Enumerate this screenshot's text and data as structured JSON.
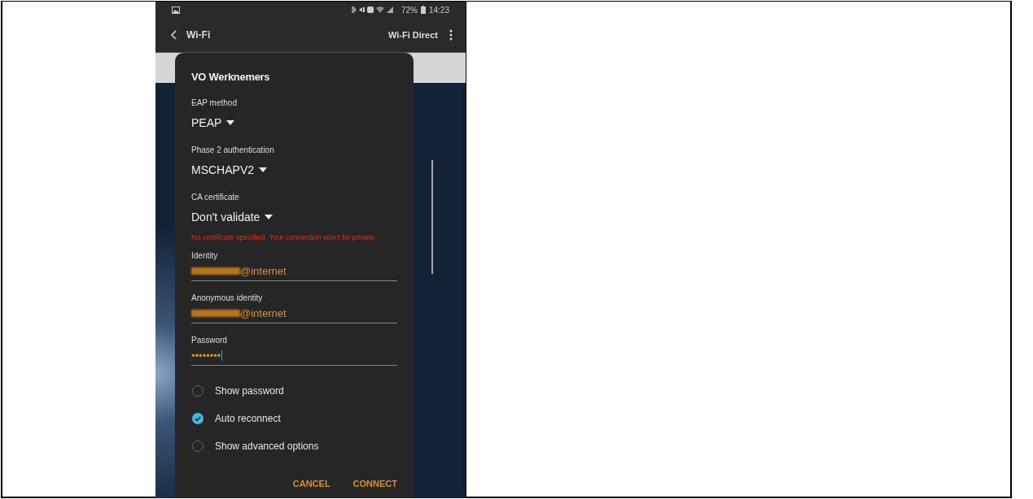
{
  "status_bar": {
    "battery": "72%",
    "time": "14:23"
  },
  "app_bar": {
    "title": "Wi-Fi",
    "action": "Wi-Fi Direct"
  },
  "dialog": {
    "title": "VO Werknemers",
    "dropdowns": [
      {
        "label": "EAP method",
        "value": "PEAP"
      },
      {
        "label": "Phase 2 authentication",
        "value": "MSCHAPV2"
      },
      {
        "label": "CA certificate",
        "value": "Don't validate"
      }
    ],
    "warning": "No certificate specified. Your connection won't be private.",
    "fields": [
      {
        "label": "Identity",
        "value": "@internet",
        "redacted": true
      },
      {
        "label": "Anonymous identity",
        "value": "@internet",
        "redacted": true
      },
      {
        "label": "Password",
        "value": "••••••••",
        "redacted": false
      }
    ],
    "options": [
      {
        "label": "Show password",
        "checked": false
      },
      {
        "label": "Auto reconnect",
        "checked": true
      },
      {
        "label": "Show advanced options",
        "checked": false
      }
    ],
    "buttons": [
      "CANCEL",
      "CONNECT"
    ]
  }
}
